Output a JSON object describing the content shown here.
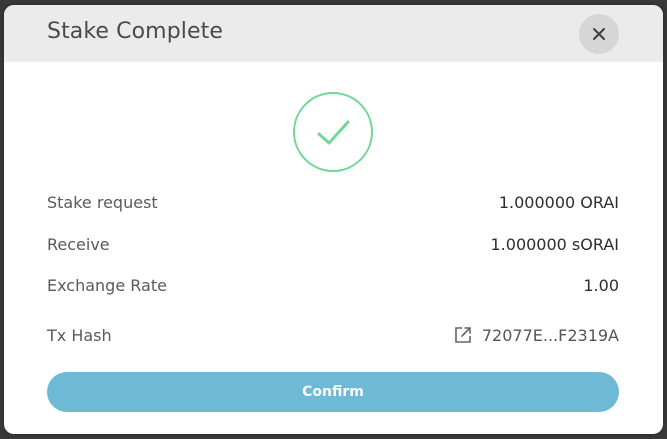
{
  "modal": {
    "title": "Stake Complete",
    "close_icon": "close-icon",
    "status_icon": "checkmark-icon",
    "status_color": "#6fd896"
  },
  "details": [
    {
      "label": "Stake request",
      "value": "1.000000 ORAI"
    },
    {
      "label": "Receive",
      "value": "1.000000 sORAI"
    },
    {
      "label": "Exchange Rate",
      "value": "1.00"
    }
  ],
  "tx": {
    "label": "Tx Hash",
    "value": "72077E...F2319A",
    "icon": "external-link-icon"
  },
  "confirm": {
    "label": "Confirm",
    "color": "#6db9d6"
  }
}
